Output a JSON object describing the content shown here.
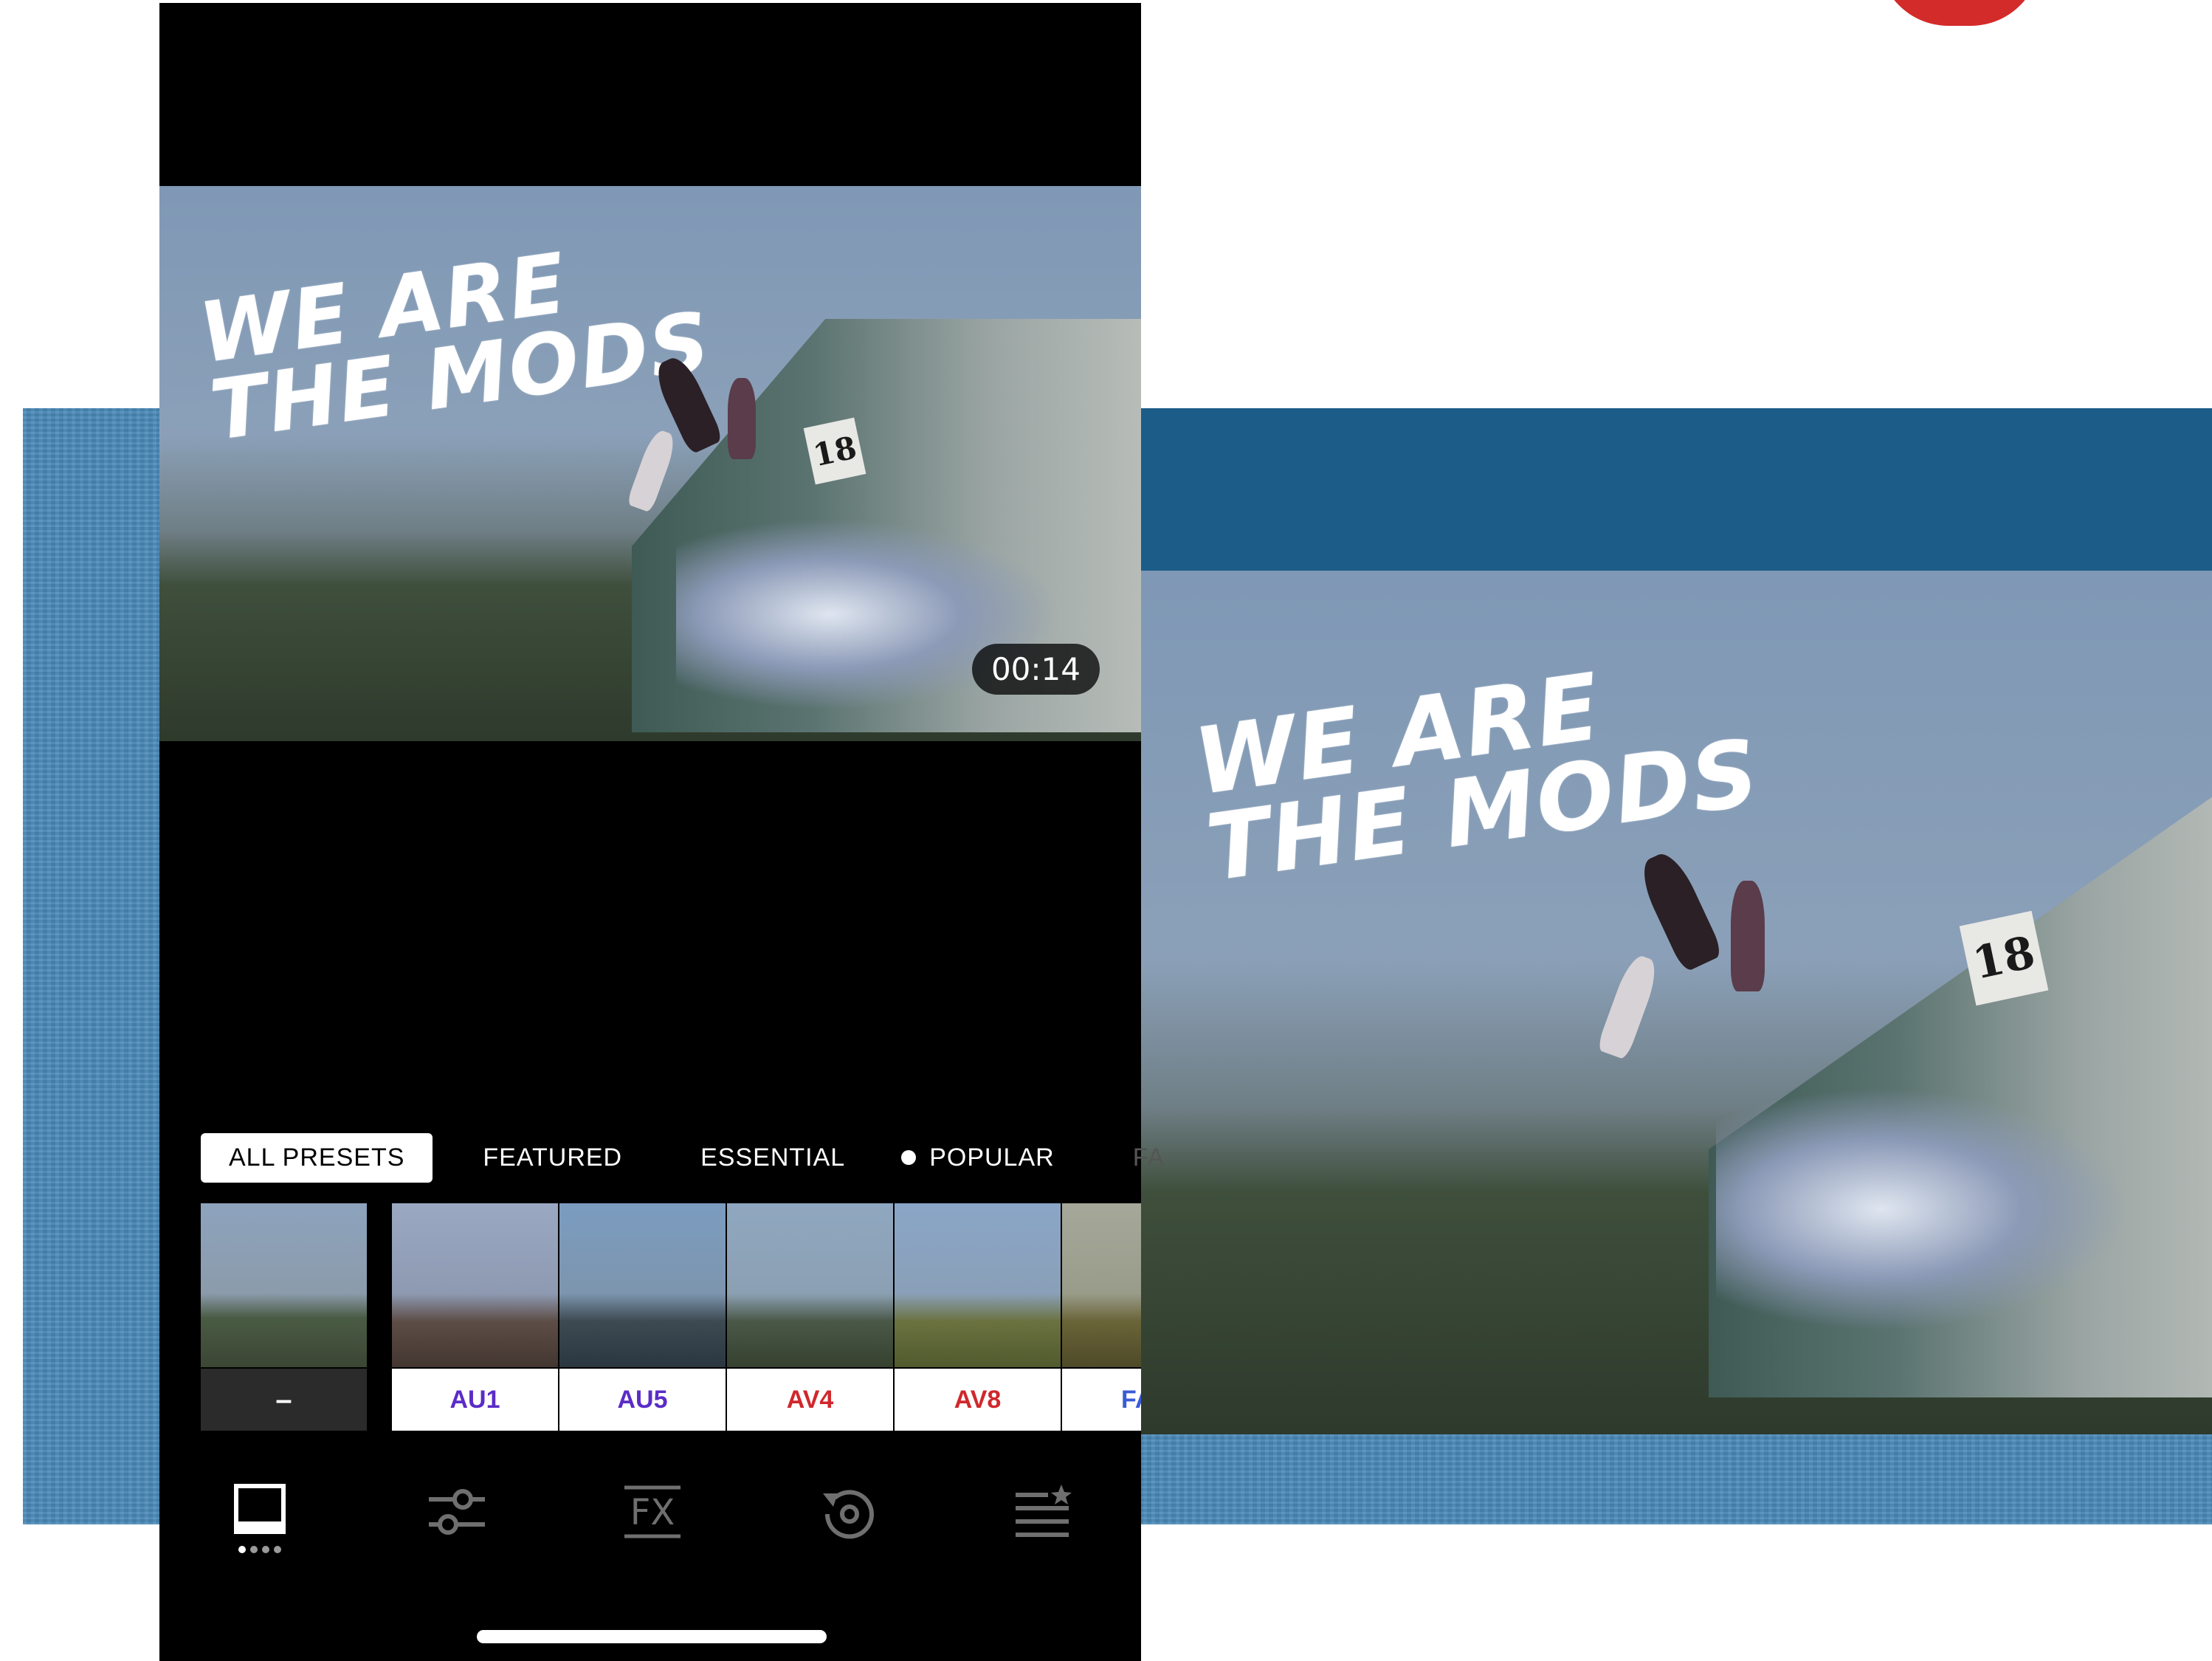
{
  "video": {
    "title_line1": "WE ARE",
    "title_line2": "THE MODS",
    "wall_number": "18",
    "timestamp": "00:14"
  },
  "tabs": [
    {
      "label": "ALL PRESETS",
      "active": true
    },
    {
      "label": "FEATURED",
      "active": false
    },
    {
      "label": "ESSENTIAL",
      "active": false
    },
    {
      "label": "POPULAR",
      "active": false
    },
    {
      "label": "FA",
      "active": false
    }
  ],
  "presets": [
    {
      "label": "–",
      "color": "#ffffff"
    },
    {
      "label": "AU1",
      "color": "#5b2cc7"
    },
    {
      "label": "AU5",
      "color": "#5b2cc7"
    },
    {
      "label": "AV4",
      "color": "#d0282c"
    },
    {
      "label": "AV8",
      "color": "#d0282c"
    },
    {
      "label": "FA",
      "color": "#3a5bd6"
    }
  ],
  "toolbar": {
    "fx_label": "FX",
    "icons": [
      "presets-icon",
      "adjust-sliders-icon",
      "fx-icon",
      "history-icon",
      "favorites-icon"
    ]
  },
  "colors": {
    "band": "#4a8ab8",
    "band_dark": "#1c5c88",
    "phone_bg": "#000000"
  }
}
